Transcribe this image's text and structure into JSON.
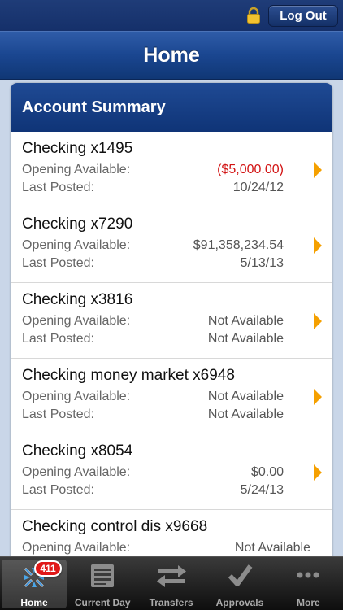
{
  "topbar": {
    "logout_label": "Log Out"
  },
  "header": {
    "title": "Home"
  },
  "summary": {
    "title": "Account Summary",
    "opening_label": "Opening Available:",
    "posted_label": "Last Posted:",
    "accounts": [
      {
        "name": "Checking x1495",
        "opening": "($5,000.00)",
        "posted": "10/24/12",
        "negative": true
      },
      {
        "name": "Checking x7290",
        "opening": "$91,358,234.54",
        "posted": "5/13/13"
      },
      {
        "name": "Checking x3816",
        "opening": "Not Available",
        "posted": "Not Available"
      },
      {
        "name": "Checking money market x6948",
        "opening": "Not Available",
        "posted": "Not Available"
      },
      {
        "name": "Checking x8054",
        "opening": "$0.00",
        "posted": "5/24/13"
      },
      {
        "name": "Checking control dis x9668",
        "opening": "Not Available",
        "posted": ""
      }
    ]
  },
  "tabbar": {
    "badge": "411",
    "tabs": [
      {
        "label": "Home",
        "icon": "home-icon"
      },
      {
        "label": "Current Day",
        "icon": "document-icon"
      },
      {
        "label": "Transfers",
        "icon": "transfer-arrows-icon"
      },
      {
        "label": "Approvals",
        "icon": "checkmark-icon"
      },
      {
        "label": "More",
        "icon": "ellipsis-icon"
      }
    ]
  },
  "colors": {
    "brand_blue": "#1a4690",
    "negative_red": "#d21414",
    "chevron_orange": "#f5a000",
    "badge_red": "#e01818"
  }
}
